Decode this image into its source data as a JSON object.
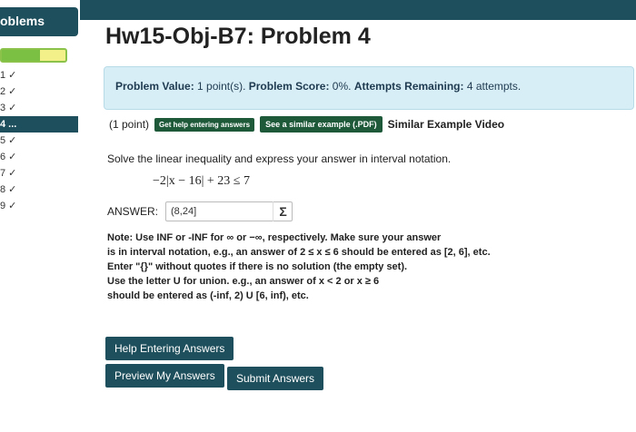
{
  "sidebar": {
    "header": "oblems",
    "progress_fraction": 0.6,
    "items": [
      {
        "label": "1 ✓"
      },
      {
        "label": "2 ✓"
      },
      {
        "label": "3 ✓"
      },
      {
        "label": "4 ..."
      },
      {
        "label": "5 ✓"
      },
      {
        "label": "6 ✓"
      },
      {
        "label": "7 ✓"
      },
      {
        "label": "8 ✓"
      },
      {
        "label": "9 ✓"
      }
    ]
  },
  "main": {
    "title": "Hw15-Obj-B7: Problem 4",
    "info": {
      "value_label": "Problem Value:",
      "value": "1 point(s).",
      "score_label": "Problem Score:",
      "score": "0%.",
      "attempts_label": "Attempts Remaining:",
      "attempts": "4 attempts."
    },
    "points": "(1 point)",
    "help_link": "Get help entering answers",
    "similar_link": "See a similar example (.PDF)",
    "video_link": "Similar Example Video",
    "statement": "Solve the linear inequality and express your answer in interval notation.",
    "inequality": "−2|x − 16| + 23 ≤ 7",
    "answer_label": "ANSWER:",
    "answer_value": "(8,24]",
    "note_lines": [
      "Note: Use INF or -INF for ∞ or −∞, respectively. Make sure your answer",
      "is in interval notation, e.g., an answer of 2 ≤ x ≤ 6 should be entered as [2, 6], etc.",
      "Enter \"{}\" without quotes if there is no solution (the empty set).",
      "Use the letter U for union. e.g., an answer of x < 2 or x ≥ 6",
      "should be entered as (-inf, 2) U [6, inf), etc."
    ],
    "buttons": {
      "help": "Help Entering Answers",
      "preview": "Preview My Answers",
      "submit": "Submit Answers"
    }
  },
  "colors": {
    "primary": "#1e4f5c",
    "info_bg": "#d8eef6",
    "green_btn": "#1e5a3a"
  }
}
